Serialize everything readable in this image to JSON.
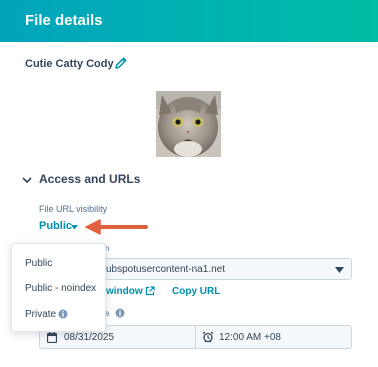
{
  "header": {
    "title": "File details"
  },
  "file": {
    "name": "Cutie Catty Cody"
  },
  "access": {
    "section_title": "Access and URLs",
    "visibility_label": "File URL visibility",
    "visibility_value": "Public",
    "domain_label": "n",
    "domain_value": "ubspotusercontent-na1.net",
    "open_window_label": "window",
    "copy_url_label": "Copy URL",
    "expire_label": "e",
    "date_value": "08/31/2025",
    "time_value": "12:00 AM +08"
  },
  "dropdown": {
    "options": [
      "Public",
      "Public - noindex",
      "Private"
    ]
  },
  "colors": {
    "header_gradient_start": "#00a4bd",
    "header_gradient_end": "#00bda5",
    "link": "#0091ae",
    "arrow": "#e0613f",
    "text": "#33475b"
  },
  "icons": [
    "pencil-icon",
    "chevron-down-icon",
    "caret-down-icon",
    "external-link-icon",
    "info-icon",
    "calendar-icon",
    "alarm-clock-icon"
  ]
}
